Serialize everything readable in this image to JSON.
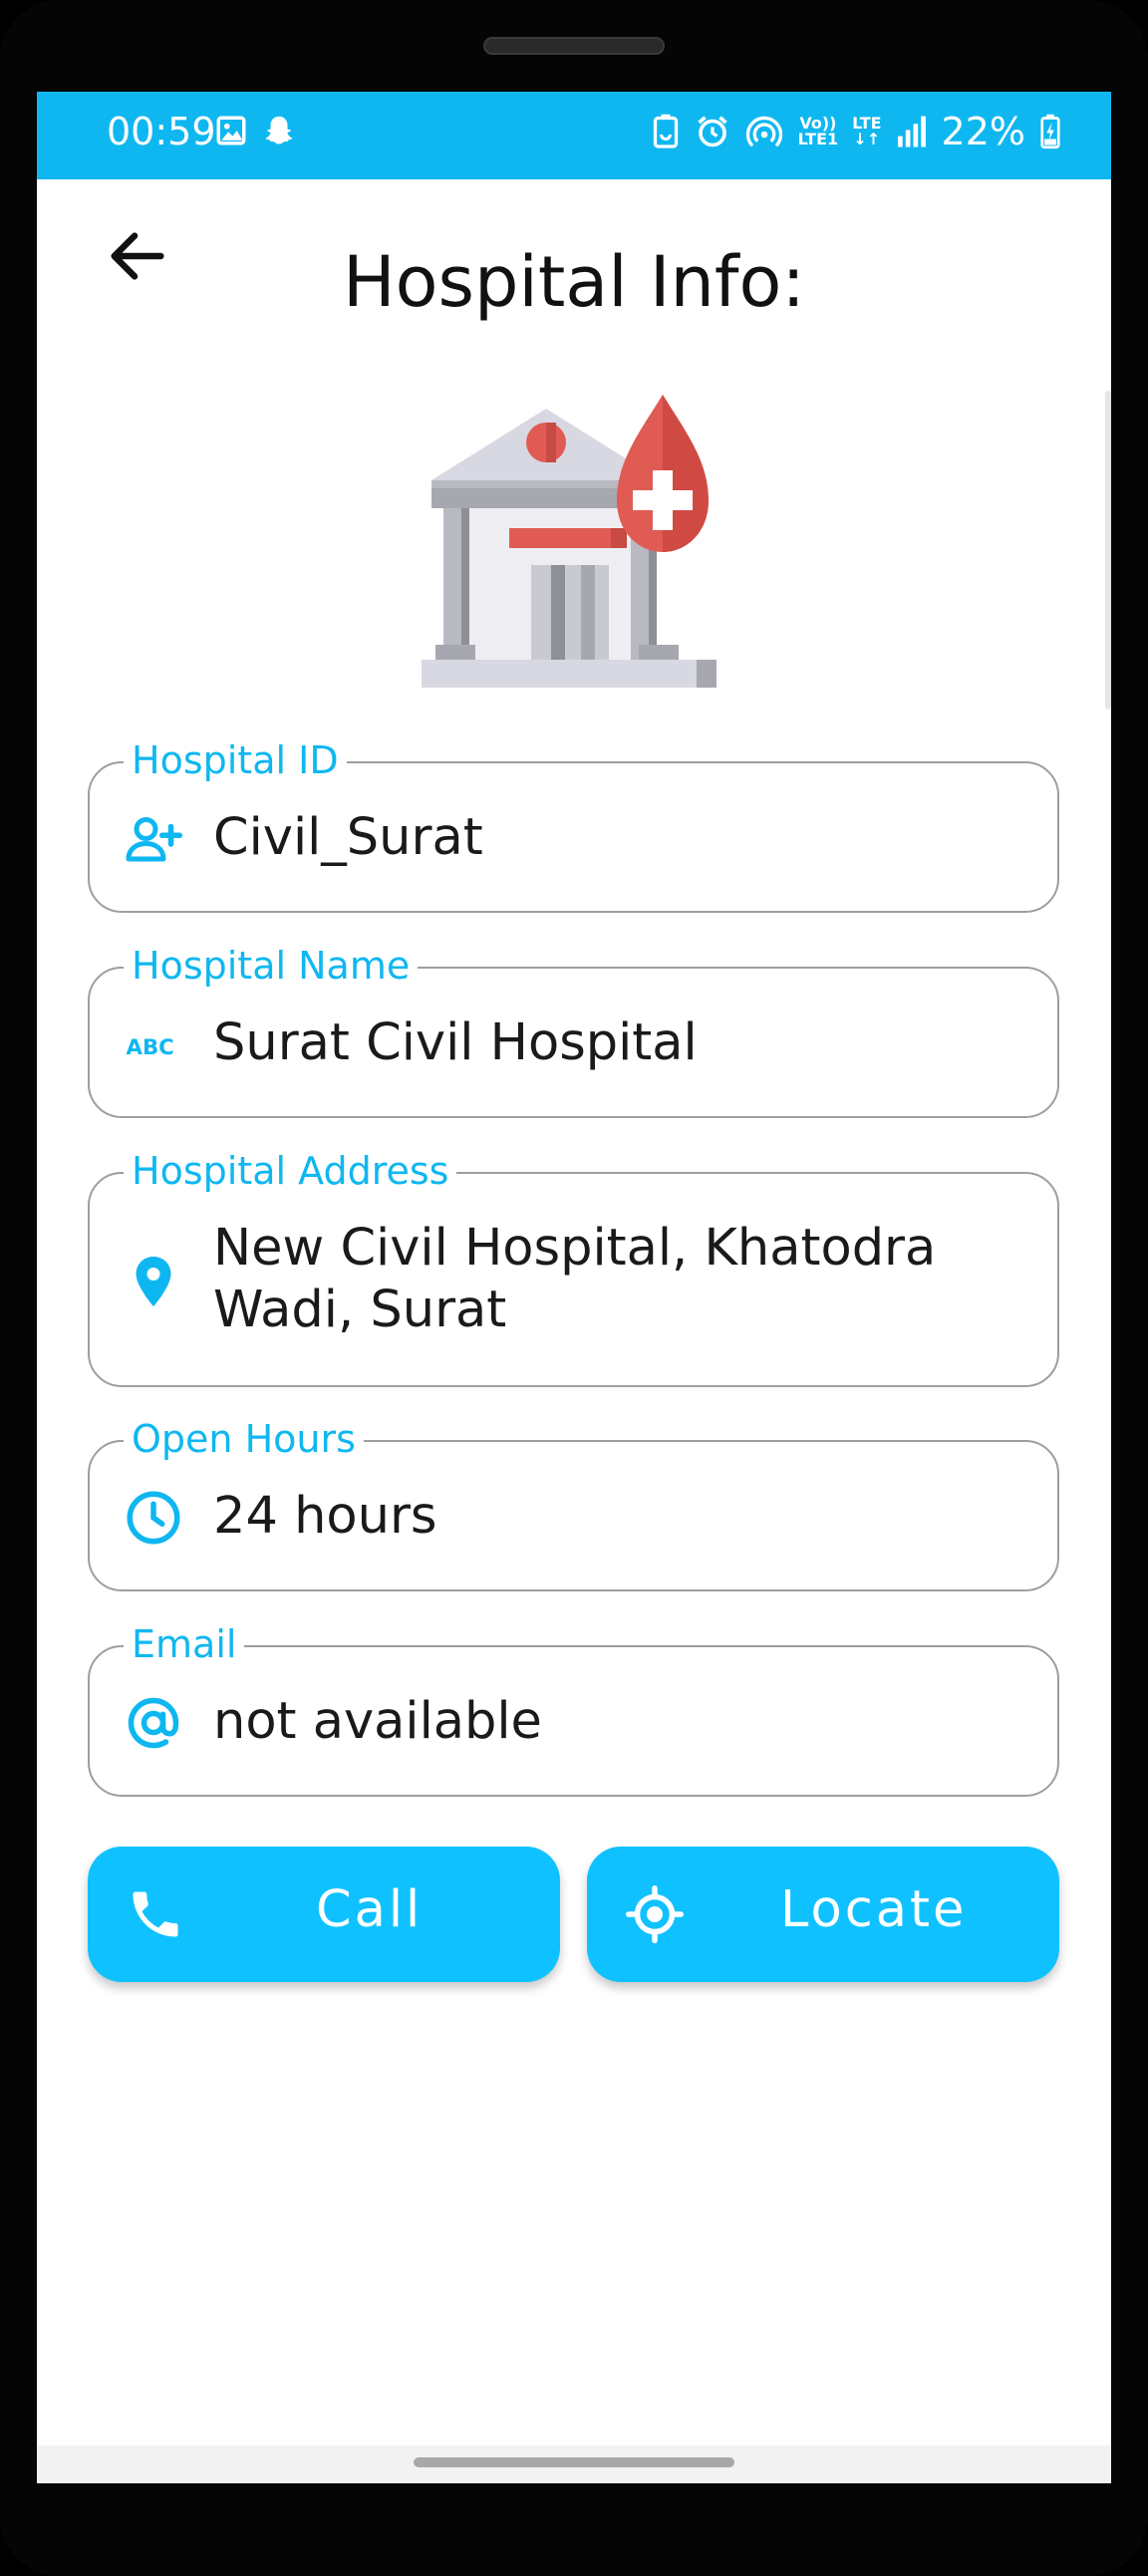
{
  "status_bar": {
    "time": "00:59",
    "battery": "22%",
    "network_top": "Vo))",
    "network_bottom": "LTE1",
    "lte": "LTE",
    "colors": {
      "background": "#0fb7f1",
      "text": "#ffffff"
    }
  },
  "header": {
    "title": "Hospital Info:",
    "back_icon": "arrow-left-icon"
  },
  "hero": {
    "icon": "hospital-blood-drop-icon"
  },
  "fields": {
    "hospital_id": {
      "label": "Hospital ID",
      "value": "Civil_Surat",
      "icon": "person-add-icon"
    },
    "hospital_name": {
      "label": "Hospital Name",
      "value": "Surat Civil Hospital",
      "icon": "abc-icon"
    },
    "hospital_address": {
      "label": "Hospital Address",
      "value": "New Civil Hospital, Khatodra Wadi, Surat",
      "icon": "location-pin-icon"
    },
    "open_hours": {
      "label": "Open Hours",
      "value": "24 hours",
      "icon": "clock-icon"
    },
    "email": {
      "label": "Email",
      "value": "not available",
      "icon": "at-sign-icon"
    }
  },
  "buttons": {
    "call": {
      "label": "Call",
      "icon": "phone-icon"
    },
    "locate": {
      "label": "Locate",
      "icon": "gps-target-icon"
    }
  },
  "colors": {
    "accent": "#0fb7f1",
    "button": "#0fc2ff",
    "border": "#9e9e9e"
  }
}
